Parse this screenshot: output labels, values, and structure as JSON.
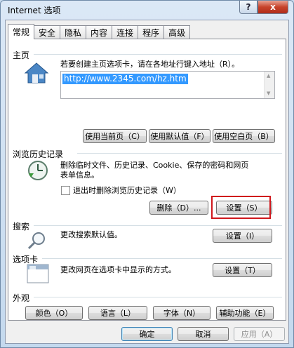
{
  "window": {
    "title": "Internet 选项",
    "help": "?",
    "close": "x"
  },
  "tabs": [
    {
      "label": "常规",
      "active": true
    },
    {
      "label": "安全"
    },
    {
      "label": "隐私"
    },
    {
      "label": "内容"
    },
    {
      "label": "连接"
    },
    {
      "label": "程序"
    },
    {
      "label": "高级"
    }
  ],
  "homepage": {
    "title": "主页",
    "desc": "若要创建主页选项卡，请在各地址行键入地址（R）。",
    "url": "http://www.2345.com/hz.htm",
    "btn_current": "使用当前页（C）",
    "btn_default": "使用默认值（F）",
    "btn_blank": "使用空白页（B）"
  },
  "history": {
    "title": "浏览历史记录",
    "desc_line1": "删除临时文件、历史记录、Cookie、保存的密码和网页",
    "desc_line2": "表单信息。",
    "checkbox_label": "退出时删除浏览历史记录（W）",
    "btn_delete": "删除（D）...",
    "btn_settings": "设置（S）"
  },
  "search": {
    "title": "搜索",
    "desc": "更改搜索默认值。",
    "btn_settings": "设置（I）"
  },
  "tabs_section": {
    "title": "选项卡",
    "desc": "更改网页在选项卡中显示的方式。",
    "btn_settings": "设置（T）"
  },
  "appearance": {
    "title": "外观",
    "btn_colors": "颜色（O）",
    "btn_languages": "语言（L）",
    "btn_fonts": "字体（N）",
    "btn_accessibility": "辅助功能（E）"
  },
  "footer": {
    "ok": "确定",
    "cancel": "取消",
    "apply": "应用（A）"
  }
}
